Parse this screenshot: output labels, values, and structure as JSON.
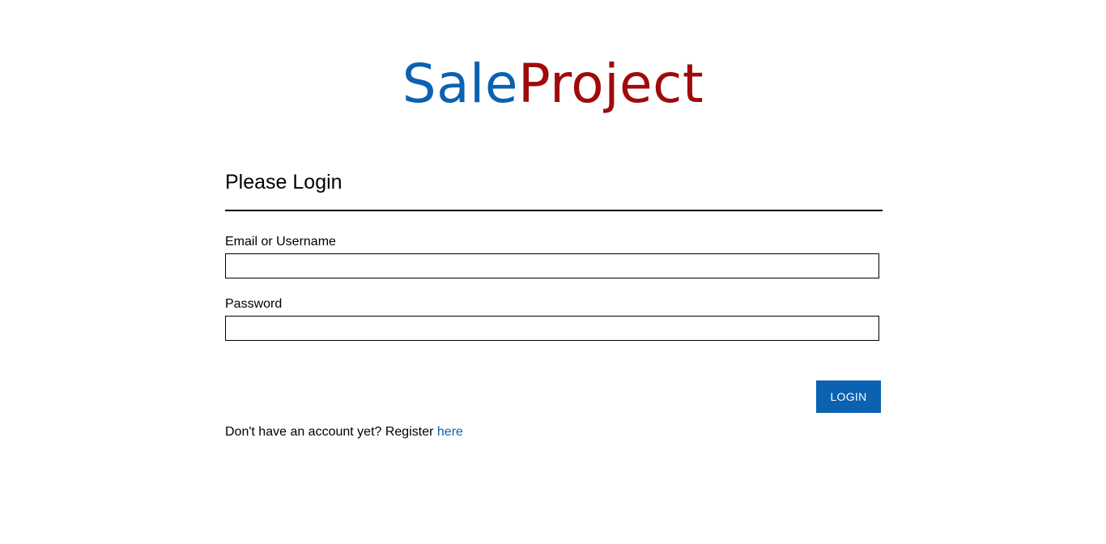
{
  "brand": {
    "name_part_1": "Sale",
    "name_part_2": "Project",
    "colors": {
      "part_1": "#0a62b0",
      "part_2": "#a00a0a"
    }
  },
  "login_form": {
    "heading": "Please Login",
    "username_label": "Email or Username",
    "username_value": "",
    "password_label": "Password",
    "password_value": "",
    "submit_label": "LOGIN",
    "accent_color": "#0a62b0"
  },
  "register": {
    "prompt": "Don't have an account yet? Register",
    "link_label": "here"
  }
}
